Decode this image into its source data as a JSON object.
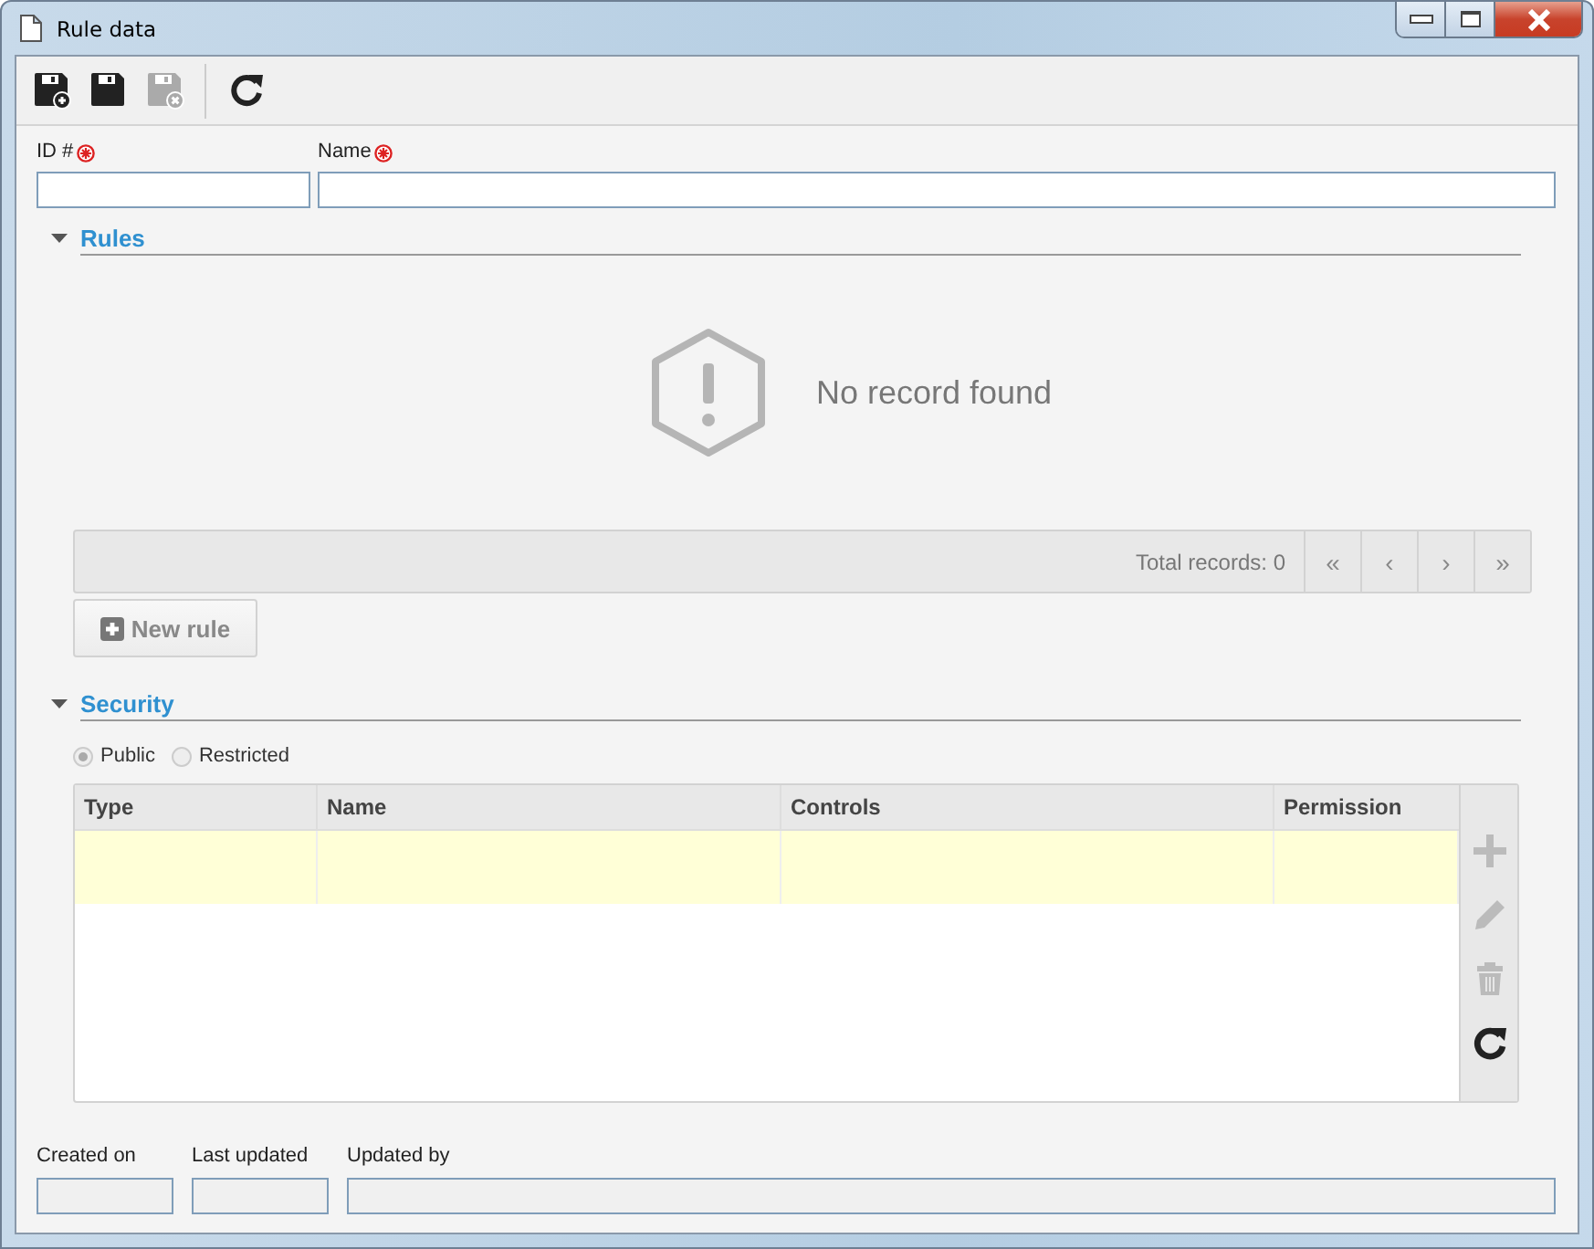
{
  "window": {
    "title": "Rule data"
  },
  "toolbar": [
    {
      "kind": "save-new",
      "disabled": false
    },
    {
      "kind": "save",
      "disabled": false
    },
    {
      "kind": "save-close",
      "disabled": true
    },
    {
      "kind": "refresh",
      "disabled": false
    }
  ],
  "fields": [
    {
      "label": "ID #",
      "required": true
    },
    {
      "label": "Name",
      "required": true
    }
  ],
  "rules": {
    "title": "Rules",
    "expanded": true,
    "empty_message": "No record found",
    "total_records": "Total records: 0",
    "pager": [
      "«",
      "‹",
      "›",
      "»"
    ],
    "new_button": "New rule"
  },
  "security": {
    "title": "Security",
    "expanded": true,
    "radios": [
      {
        "label": "Public",
        "selected": true
      },
      {
        "label": "Restricted",
        "selected": false
      }
    ],
    "columns": [
      "Type",
      "Name",
      "Controls",
      "Permission"
    ],
    "rows": [
      {
        "selected": true
      }
    ],
    "tools": [
      {
        "kind": "add",
        "disabled": true
      },
      {
        "kind": "edit",
        "disabled": true
      },
      {
        "kind": "delete",
        "disabled": true
      },
      {
        "kind": "refresh",
        "disabled": false
      }
    ]
  },
  "footer": [
    {
      "label": "Created on"
    },
    {
      "label": "Last updated"
    },
    {
      "label": "Updated by"
    }
  ]
}
